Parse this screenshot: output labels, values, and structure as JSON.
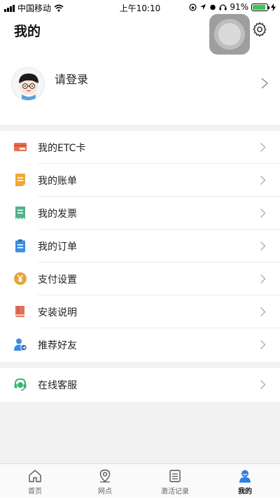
{
  "status_bar": {
    "carrier": "中国移动",
    "time": "上午10:10",
    "battery": "91%",
    "battery_level": 0.91,
    "battery_color": "#34c759"
  },
  "header": {
    "title": "我的",
    "settings_icon": "gear-icon",
    "login_label": "请登录"
  },
  "menu": [
    {
      "label": "我的ETC卡",
      "icon": "etc-card-icon",
      "color": "#e8704f"
    },
    {
      "label": "我的账单",
      "icon": "bill-icon",
      "color": "#f0a836"
    },
    {
      "label": "我的发票",
      "icon": "invoice-icon",
      "color": "#4fb38a"
    },
    {
      "label": "我的订单",
      "icon": "order-icon",
      "color": "#3d8ee0"
    },
    {
      "label": "支付设置",
      "icon": "yuan-icon",
      "color": "#e8a33d"
    },
    {
      "label": "安装说明",
      "icon": "book-icon",
      "color": "#e0705a"
    },
    {
      "label": "推荐好友",
      "icon": "recommend-friend-icon",
      "color": "#3d8ee0"
    }
  ],
  "service": {
    "label": "在线客服",
    "icon": "headset-icon",
    "color": "#3cb371"
  },
  "tabs": [
    {
      "label": "首页",
      "icon": "home-icon"
    },
    {
      "label": "网点",
      "icon": "location-icon"
    },
    {
      "label": "激活记录",
      "icon": "record-icon"
    },
    {
      "label": "我的",
      "icon": "profile-icon"
    }
  ],
  "active_tab": "我的",
  "colors": {
    "accent": "#2f7fe0",
    "background": "#f2f2f2"
  }
}
